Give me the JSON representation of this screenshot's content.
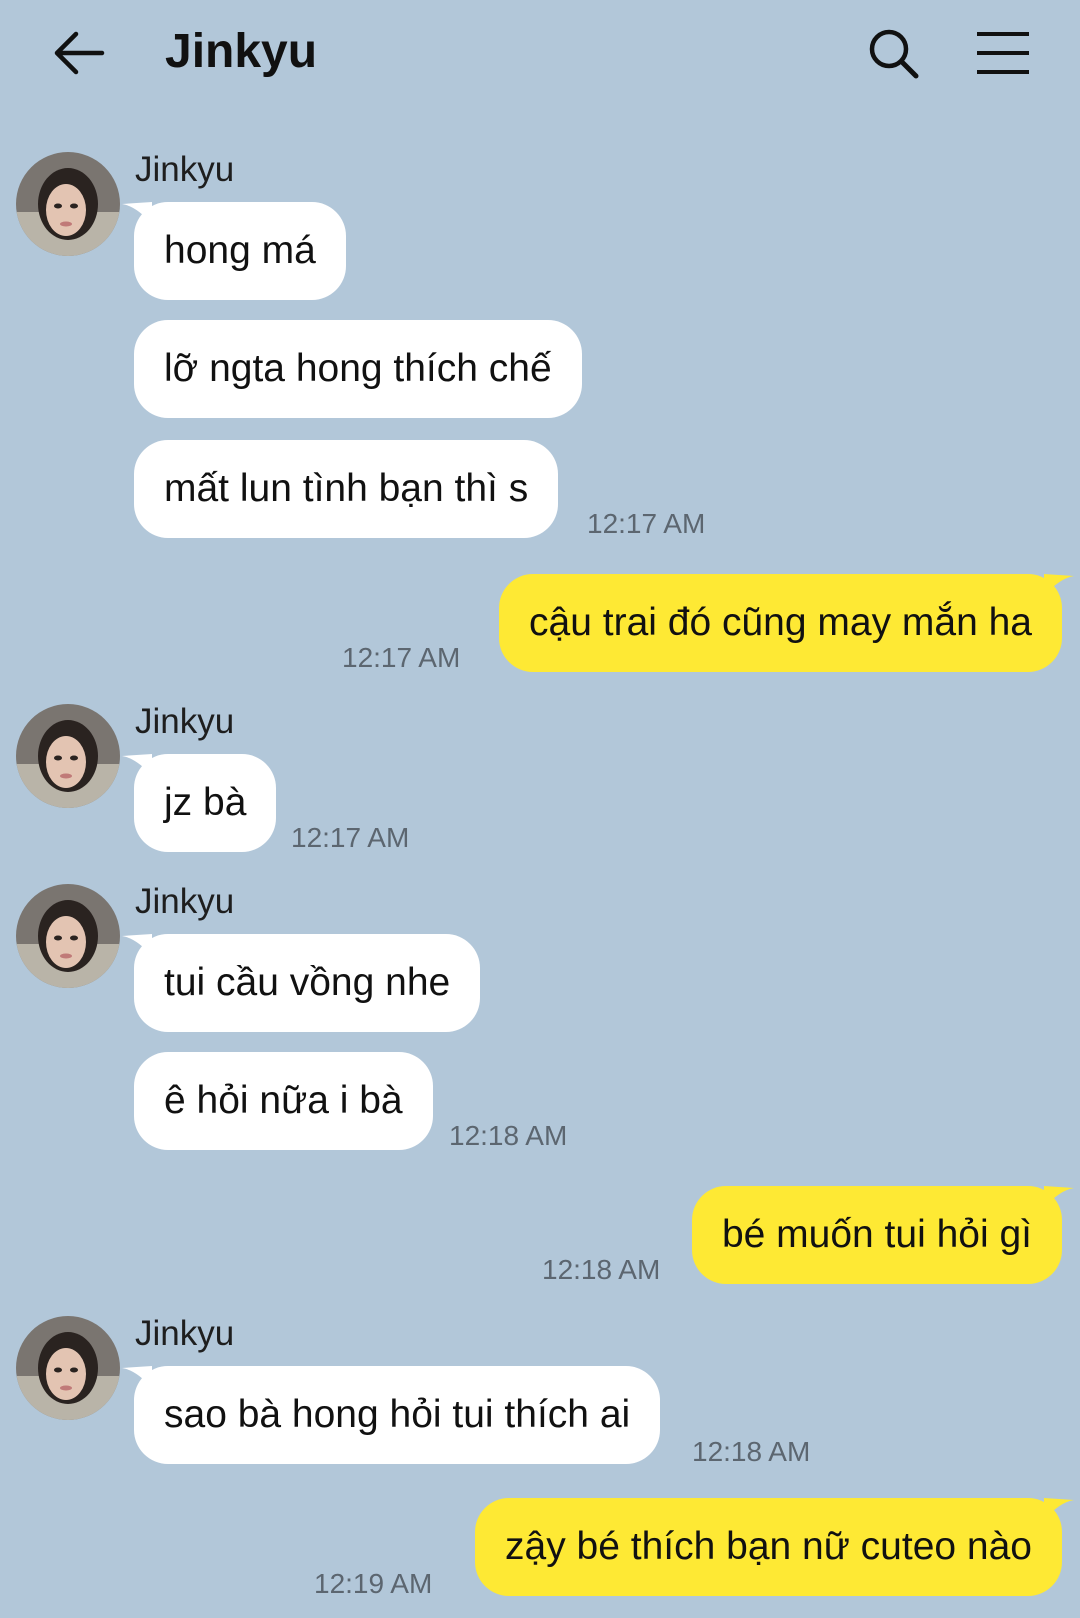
{
  "header": {
    "title": "Jinkyu"
  },
  "sender_name": "Jinkyu",
  "messages": [
    {
      "text": "hong má"
    },
    {
      "text": "lỡ ngta hong thích chế"
    },
    {
      "text": "mất lun tình bạn thì s",
      "time": "12:17 AM"
    },
    {
      "text": "cậu trai đó cũng may mắn ha",
      "time": "12:17 AM"
    },
    {
      "text": "jz bà",
      "time": "12:17 AM"
    },
    {
      "text": "tui cầu vồng nhe"
    },
    {
      "text": "ê hỏi nữa i bà",
      "time": "12:18 AM"
    },
    {
      "text": "bé muốn tui hỏi gì",
      "time": "12:18 AM"
    },
    {
      "text": "sao bà hong hỏi tui thích ai",
      "time": "12:18 AM"
    },
    {
      "text": "zậy bé thích bạn nữ cuteo nào",
      "time": "12:19 AM"
    }
  ],
  "colors": {
    "background": "#b2c7d9",
    "incoming_bubble": "#ffffff",
    "outgoing_bubble": "#fee934"
  },
  "icons": [
    "back-arrow-icon",
    "search-icon",
    "menu-icon"
  ]
}
